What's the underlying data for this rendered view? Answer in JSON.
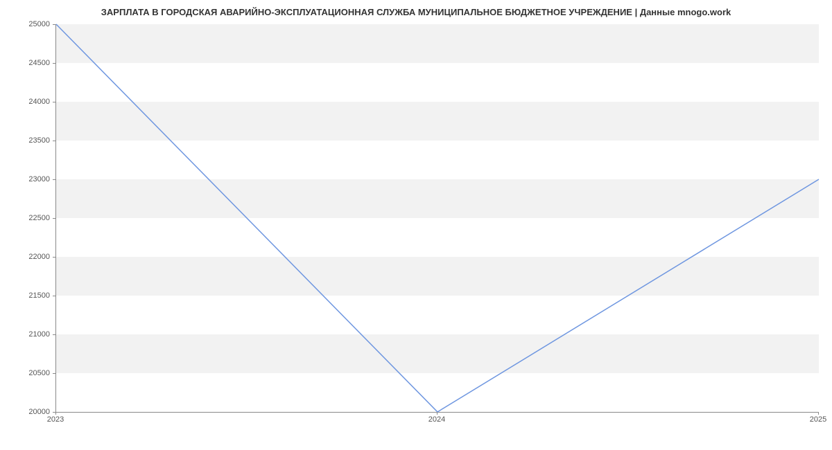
{
  "chart_data": {
    "type": "line",
    "title": "ЗАРПЛАТА В ГОРОДСКАЯ АВАРИЙНО-ЭКСПЛУАТАЦИОННАЯ СЛУЖБА МУНИЦИПАЛЬНОЕ БЮДЖЕТНОЕ УЧРЕЖДЕНИЕ | Данные mnogo.work",
    "xlabel": "",
    "ylabel": "",
    "x": [
      "2023",
      "2024",
      "2025"
    ],
    "values": [
      25000,
      20000,
      23000
    ],
    "y_ticks": [
      20000,
      20500,
      21000,
      21500,
      22000,
      22500,
      23000,
      23500,
      24000,
      24500,
      25000
    ],
    "x_ticks": [
      "2023",
      "2024",
      "2025"
    ],
    "ylim": [
      20000,
      25000
    ],
    "line_color": "#6e96e0"
  }
}
